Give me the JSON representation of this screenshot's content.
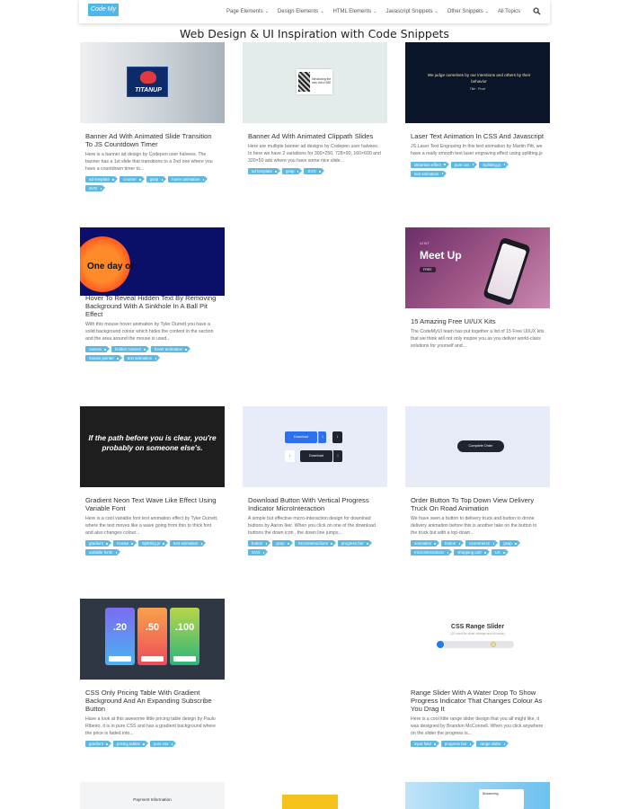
{
  "header": {
    "logo": "Code My UI",
    "nav": [
      {
        "label": "Page Elements",
        "chevron": true
      },
      {
        "label": "Design Elements",
        "chevron": true
      },
      {
        "label": "HTML Elements",
        "chevron": true
      },
      {
        "label": "Javascript Snippets",
        "chevron": true
      },
      {
        "label": "Other Snippets",
        "chevron": true
      },
      {
        "label": "All Topics",
        "chevron": false
      }
    ],
    "chevron_glyph": "⌄",
    "search_icon": "search-icon"
  },
  "page_title": "Web Design & UI Inspiration with Code Snippets",
  "cards": [
    {
      "title": "Banner Ad With Animated Slide Transition To JS Countdown Timer",
      "desc": "Here is a banner ad design by Codepen user halvees. The banner has a 1st slide that transitions to a 2nd one where you have a countdown timer to...",
      "tags": [
        "ad template",
        "counter",
        "gsap",
        "hover animation",
        "SVG"
      ],
      "thumb_text": "TITANUP"
    },
    {
      "title": "Banner Ad With Animated Clippath Slides",
      "desc": "Here are multiple banner ad designs by Codepen user halvees. In here we have 2 variations for 300×250, 728×90, 160×600 and 320×50 ads where you have some nice slide...",
      "tags": [
        "ad template",
        "gsap",
        "SVG"
      ],
      "thumb_text": "Introducing the new Volvo S60"
    },
    {
      "title": "Laser Text Animation In CSS And Javascript",
      "desc": "JS Laser Text Engraving In this text animation by Martin Pitt, we have a really smooth text laser engraving effect using splitting.js",
      "tags": [
        "distortion effect",
        "pure css",
        "Splitting.js",
        "text animation"
      ],
      "thumb_text": "We judge ourselves by our intentions and others by their behavior",
      "thumb_sub": "Title · Proof"
    },
    {
      "title": "Hover To Reveal Hidden Text By Removing Background With A Sinkhole In A Ball Pit Effect",
      "desc": "With this mouse hover animation by Tyler Durrett you have a solid background colour which hides the content in the section and the area around the mouse is used...",
      "tags": [
        "canvas",
        "hidden content",
        "hover animation",
        "mouse pointer",
        "text animation"
      ],
      "thumb_text": "One day or"
    },
    {
      "title": "15 Amazing Free UI/UX Kits",
      "desc": "The CodeMyUI team has put together a list of 15 Free UI/UX kits that we think will not only inspire you as you deliver world-class solutions for yourself and...",
      "tags": [],
      "thumb_text": "Meet Up",
      "thumb_small": "UI KIT",
      "thumb_badge": "FREE"
    },
    {
      "title": "Gradient Neon Text Wave Like Effect Using Variable Font",
      "desc": "Here is a cool variable font text animation effect by Tyler Durrett, where the text moves like a wave going from thin to thick font and also changes colour...",
      "tags": [
        "gradient",
        "mouse",
        "Splitting.js",
        "text animation",
        "variable fonts"
      ],
      "thumb_text": "If the path before you is clear, you're probably on someone else's."
    },
    {
      "title": "Download Button With Vertical Progress Indicator MicroInteraction",
      "desc": "A simple but effective micro-interaction design for download buttons by Aaron Iker. When you click on one of the download buttons the down icon , the down line jumps...",
      "tags": [
        "button",
        "gsap",
        "microinteractions",
        "progress bar",
        "SVG"
      ],
      "thumb_text": "Download"
    },
    {
      "title": "Order Button To Top Down View Delivery Truck On Road Animation",
      "desc": "We have seen a button to delivery truck and button to drone delivery animation before this is another take on the button to the truck but with a top-down...",
      "tags": [
        "animation",
        "button",
        "ecommerce",
        "gsap",
        "microinteractions",
        "shopping cart",
        "UX"
      ],
      "thumb_text": "Complete Order"
    },
    {
      "title": "CSS Only Pricing Table With Gradient Background And An Expanding Subscribe Button",
      "desc": "Have a look at this awesome little pricing table design by Paulo Ribeiro, it is in pure CSS and has a gradient background where the price is faded into...",
      "tags": [
        "gradient",
        "pricing tables",
        "pure css"
      ],
      "prices": [
        ".20",
        ".50",
        ".100"
      ]
    },
    {
      "title": "Range Slider With A Water Drop To Show Progress Indicator That Changes Colour As You Drag It",
      "desc": "Here is a cool little range slider design that you all might like, it was designed by Brandon McConnell. When you click anywhere on the slider the progress is...",
      "tags": [
        "input field",
        "progress bar",
        "range slider"
      ],
      "thumb_text": "CSS Range Slider",
      "thumb_sub": "(JS used for slider change and fill value)"
    }
  ],
  "bottom_row": [
    {
      "thumb_text": "Payment Information"
    },
    {
      "thumb_text": ""
    },
    {
      "thumb_text": "Blossoming"
    }
  ]
}
